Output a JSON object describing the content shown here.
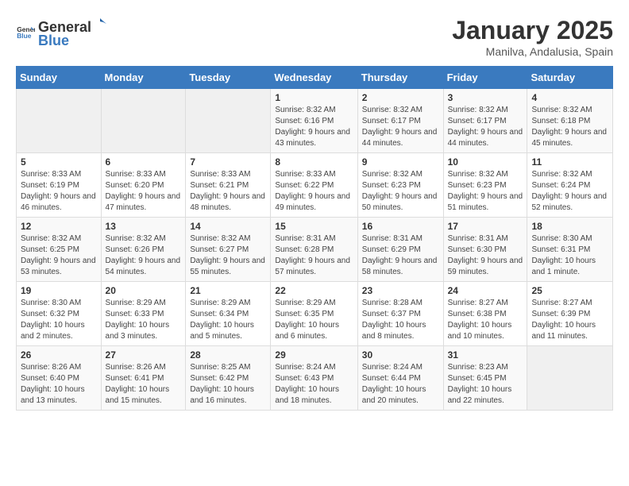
{
  "logo": {
    "text_general": "General",
    "text_blue": "Blue"
  },
  "calendar": {
    "title": "January 2025",
    "subtitle": "Manilva, Andalusia, Spain",
    "days_of_week": [
      "Sunday",
      "Monday",
      "Tuesday",
      "Wednesday",
      "Thursday",
      "Friday",
      "Saturday"
    ],
    "weeks": [
      [
        {
          "day": "",
          "info": ""
        },
        {
          "day": "",
          "info": ""
        },
        {
          "day": "",
          "info": ""
        },
        {
          "day": "1",
          "info": "Sunrise: 8:32 AM\nSunset: 6:16 PM\nDaylight: 9 hours and 43 minutes."
        },
        {
          "day": "2",
          "info": "Sunrise: 8:32 AM\nSunset: 6:17 PM\nDaylight: 9 hours and 44 minutes."
        },
        {
          "day": "3",
          "info": "Sunrise: 8:32 AM\nSunset: 6:17 PM\nDaylight: 9 hours and 44 minutes."
        },
        {
          "day": "4",
          "info": "Sunrise: 8:32 AM\nSunset: 6:18 PM\nDaylight: 9 hours and 45 minutes."
        }
      ],
      [
        {
          "day": "5",
          "info": "Sunrise: 8:33 AM\nSunset: 6:19 PM\nDaylight: 9 hours and 46 minutes."
        },
        {
          "day": "6",
          "info": "Sunrise: 8:33 AM\nSunset: 6:20 PM\nDaylight: 9 hours and 47 minutes."
        },
        {
          "day": "7",
          "info": "Sunrise: 8:33 AM\nSunset: 6:21 PM\nDaylight: 9 hours and 48 minutes."
        },
        {
          "day": "8",
          "info": "Sunrise: 8:33 AM\nSunset: 6:22 PM\nDaylight: 9 hours and 49 minutes."
        },
        {
          "day": "9",
          "info": "Sunrise: 8:32 AM\nSunset: 6:23 PM\nDaylight: 9 hours and 50 minutes."
        },
        {
          "day": "10",
          "info": "Sunrise: 8:32 AM\nSunset: 6:23 PM\nDaylight: 9 hours and 51 minutes."
        },
        {
          "day": "11",
          "info": "Sunrise: 8:32 AM\nSunset: 6:24 PM\nDaylight: 9 hours and 52 minutes."
        }
      ],
      [
        {
          "day": "12",
          "info": "Sunrise: 8:32 AM\nSunset: 6:25 PM\nDaylight: 9 hours and 53 minutes."
        },
        {
          "day": "13",
          "info": "Sunrise: 8:32 AM\nSunset: 6:26 PM\nDaylight: 9 hours and 54 minutes."
        },
        {
          "day": "14",
          "info": "Sunrise: 8:32 AM\nSunset: 6:27 PM\nDaylight: 9 hours and 55 minutes."
        },
        {
          "day": "15",
          "info": "Sunrise: 8:31 AM\nSunset: 6:28 PM\nDaylight: 9 hours and 57 minutes."
        },
        {
          "day": "16",
          "info": "Sunrise: 8:31 AM\nSunset: 6:29 PM\nDaylight: 9 hours and 58 minutes."
        },
        {
          "day": "17",
          "info": "Sunrise: 8:31 AM\nSunset: 6:30 PM\nDaylight: 9 hours and 59 minutes."
        },
        {
          "day": "18",
          "info": "Sunrise: 8:30 AM\nSunset: 6:31 PM\nDaylight: 10 hours and 1 minute."
        }
      ],
      [
        {
          "day": "19",
          "info": "Sunrise: 8:30 AM\nSunset: 6:32 PM\nDaylight: 10 hours and 2 minutes."
        },
        {
          "day": "20",
          "info": "Sunrise: 8:29 AM\nSunset: 6:33 PM\nDaylight: 10 hours and 3 minutes."
        },
        {
          "day": "21",
          "info": "Sunrise: 8:29 AM\nSunset: 6:34 PM\nDaylight: 10 hours and 5 minutes."
        },
        {
          "day": "22",
          "info": "Sunrise: 8:29 AM\nSunset: 6:35 PM\nDaylight: 10 hours and 6 minutes."
        },
        {
          "day": "23",
          "info": "Sunrise: 8:28 AM\nSunset: 6:37 PM\nDaylight: 10 hours and 8 minutes."
        },
        {
          "day": "24",
          "info": "Sunrise: 8:27 AM\nSunset: 6:38 PM\nDaylight: 10 hours and 10 minutes."
        },
        {
          "day": "25",
          "info": "Sunrise: 8:27 AM\nSunset: 6:39 PM\nDaylight: 10 hours and 11 minutes."
        }
      ],
      [
        {
          "day": "26",
          "info": "Sunrise: 8:26 AM\nSunset: 6:40 PM\nDaylight: 10 hours and 13 minutes."
        },
        {
          "day": "27",
          "info": "Sunrise: 8:26 AM\nSunset: 6:41 PM\nDaylight: 10 hours and 15 minutes."
        },
        {
          "day": "28",
          "info": "Sunrise: 8:25 AM\nSunset: 6:42 PM\nDaylight: 10 hours and 16 minutes."
        },
        {
          "day": "29",
          "info": "Sunrise: 8:24 AM\nSunset: 6:43 PM\nDaylight: 10 hours and 18 minutes."
        },
        {
          "day": "30",
          "info": "Sunrise: 8:24 AM\nSunset: 6:44 PM\nDaylight: 10 hours and 20 minutes."
        },
        {
          "day": "31",
          "info": "Sunrise: 8:23 AM\nSunset: 6:45 PM\nDaylight: 10 hours and 22 minutes."
        },
        {
          "day": "",
          "info": ""
        }
      ]
    ]
  }
}
